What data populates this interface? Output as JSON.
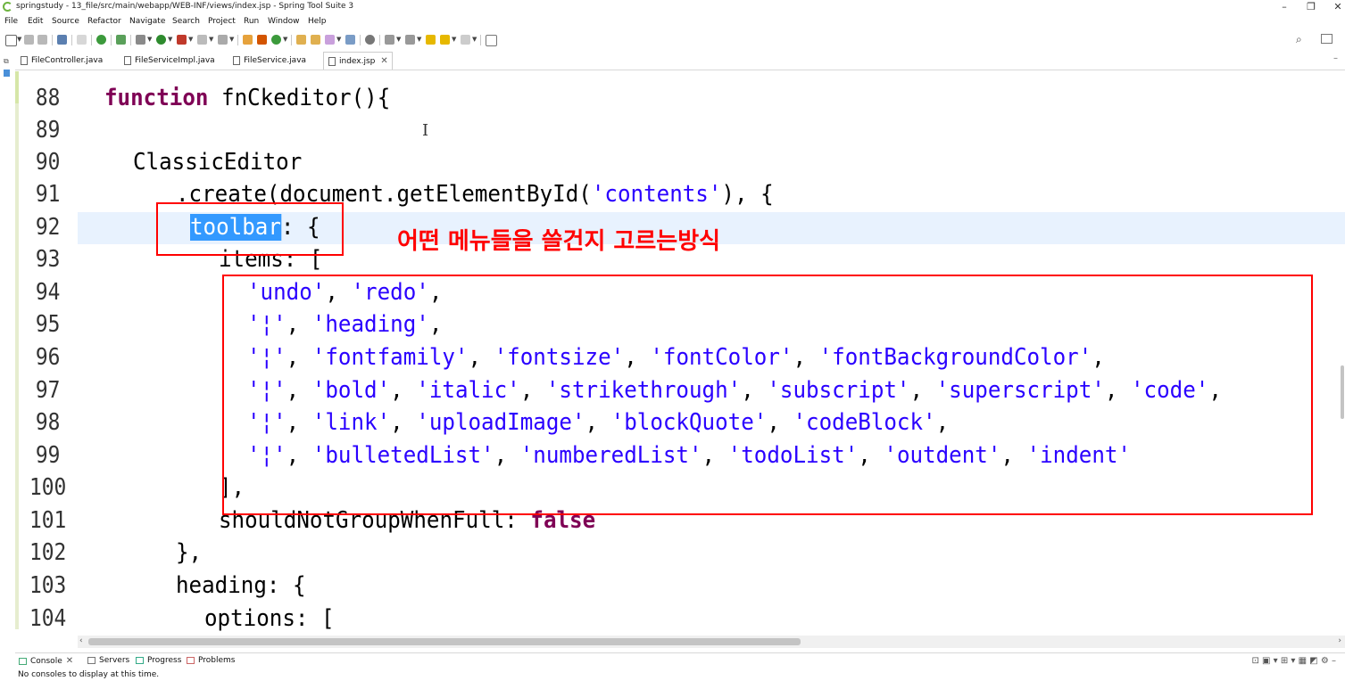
{
  "window": {
    "title": "springstudy - 13_file/src/main/webapp/WEB-INF/views/index.jsp - Spring Tool Suite 3",
    "minimize": "–",
    "restore": "❐",
    "close": "✕"
  },
  "menu": [
    "File",
    "Edit",
    "Source",
    "Refactor",
    "Navigate",
    "Search",
    "Project",
    "Run",
    "Window",
    "Help"
  ],
  "tabs": [
    {
      "label": "FileController.java",
      "active": false
    },
    {
      "label": "FileServiceImpl.java",
      "active": false
    },
    {
      "label": "FileService.java",
      "active": false
    },
    {
      "label": "index.jsp",
      "active": true
    }
  ],
  "editor": {
    "lines": [
      {
        "num": "88",
        "code": ""
      },
      {
        "num": "89",
        "code": ""
      },
      {
        "num": "90",
        "code": "ClassicEditor"
      },
      {
        "num": "91",
        "code": ""
      },
      {
        "num": "92",
        "code": ""
      },
      {
        "num": "93",
        "code": "items: ["
      },
      {
        "num": "94",
        "code": ""
      },
      {
        "num": "95",
        "code": ""
      },
      {
        "num": "96",
        "code": ""
      },
      {
        "num": "97",
        "code": ""
      },
      {
        "num": "98",
        "code": ""
      },
      {
        "num": "99",
        "code": ""
      },
      {
        "num": "100",
        "code": "],"
      },
      {
        "num": "101",
        "code": ""
      },
      {
        "num": "102",
        "code": "},"
      },
      {
        "num": "103",
        "code": "heading: {"
      },
      {
        "num": "104",
        "code": "options: ["
      }
    ],
    "kw_function": "function",
    "fn_name": " fnCkeditor(){",
    "create_pre": ".create(document.getElementById(",
    "create_str": "'contents'",
    "create_post": "), {",
    "toolbar_word": "toolbar",
    "toolbar_post": ": {",
    "should_pre": "shouldNotGroupWhenFull: ",
    "kw_false": "false",
    "sep": ", ",
    "bar": "'¦'",
    "row94": [
      "'undo'",
      "'redo'"
    ],
    "row95": [
      "'heading'"
    ],
    "row96": [
      "'fontfamily'",
      "'fontsize'",
      "'fontColor'",
      "'fontBackgroundColor'"
    ],
    "row97": [
      "'bold'",
      "'italic'",
      "'strikethrough'",
      "'subscript'",
      "'superscript'",
      "'code'"
    ],
    "row98": [
      "'link'",
      "'uploadImage'",
      "'blockQuote'",
      "'codeBlock'"
    ],
    "row99": [
      "'bulletedList'",
      "'numberedList'",
      "'todoList'",
      "'outdent'",
      "'indent'"
    ],
    "trail_comma": ","
  },
  "annotation": "어떤 메뉴들을 쓸건지 고르는방식",
  "bottom_tabs": [
    {
      "label": "Console",
      "closable": true
    },
    {
      "label": "Servers",
      "closable": false
    },
    {
      "label": "Progress",
      "closable": false
    },
    {
      "label": "Problems",
      "closable": false
    }
  ],
  "console_status": "No consoles to display at this time.",
  "colors": {
    "keyword": "#7f0055",
    "string": "#2a00ff",
    "annotation": "#ff0000",
    "selection": "#3399ff"
  }
}
